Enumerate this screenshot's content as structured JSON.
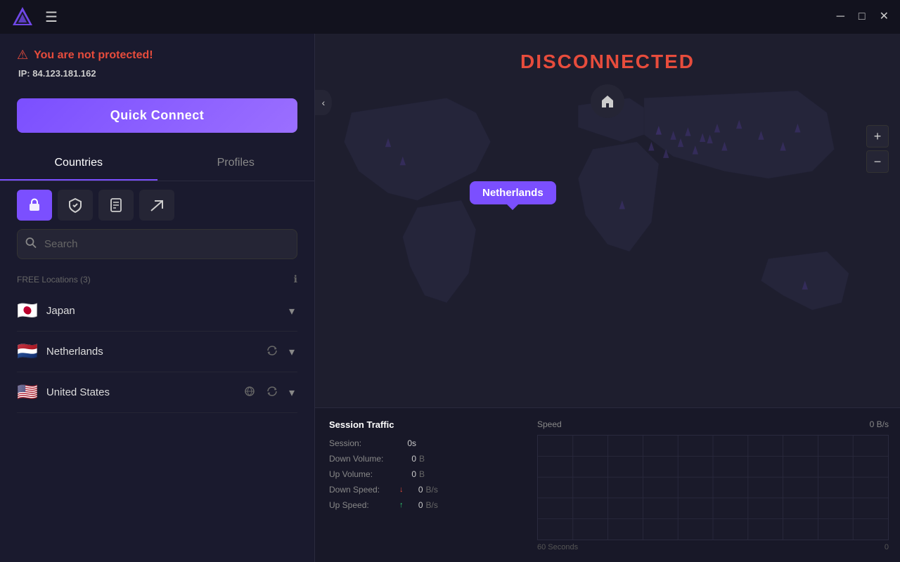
{
  "titlebar": {
    "logo_alt": "Proton VPN Logo",
    "hamburger_label": "☰",
    "minimize_label": "─",
    "maximize_label": "□",
    "close_label": "✕"
  },
  "status": {
    "not_protected_text": "You are not protected!",
    "ip_label": "IP:",
    "ip_value": "84.123.181.162",
    "disconnected_text": "DISCONNECTED"
  },
  "quick_connect": {
    "label": "Quick Connect"
  },
  "tabs": {
    "countries": "Countries",
    "profiles": "Profiles"
  },
  "filter_icons": {
    "lock_icon": "🔒",
    "shield_icon": "🛡",
    "file_icon": "📋",
    "share_icon": "↗"
  },
  "search": {
    "placeholder": "Search",
    "icon": "🔍"
  },
  "locations": {
    "free_label": "FREE Locations (3)",
    "countries": [
      {
        "name": "Japan",
        "flag": "🇯🇵",
        "has_reconnect": false
      },
      {
        "name": "Netherlands",
        "flag": "🇳🇱",
        "has_reconnect": true
      },
      {
        "name": "United States",
        "flag": "🇺🇸",
        "has_reconnect": true,
        "has_extra": true
      }
    ]
  },
  "map": {
    "netherlands_tooltip": "Netherlands",
    "home_btn": "🏠"
  },
  "zoom": {
    "plus": "+",
    "minus": "−"
  },
  "stats": {
    "session_traffic_title": "Session Traffic",
    "speed_title": "Speed",
    "speed_value": "0  B/s",
    "session_label": "Session:",
    "session_value": "0s",
    "down_volume_label": "Down Volume:",
    "down_volume_value": "0",
    "down_volume_unit": "B",
    "up_volume_label": "Up Volume:",
    "up_volume_value": "0",
    "up_volume_unit": "B",
    "down_speed_label": "Down Speed:",
    "down_speed_value": "0",
    "down_speed_unit": "B/s",
    "up_speed_label": "Up Speed:",
    "up_speed_value": "0",
    "up_speed_unit": "B/s",
    "chart_time_label": "60 Seconds",
    "chart_time_value": "0"
  }
}
